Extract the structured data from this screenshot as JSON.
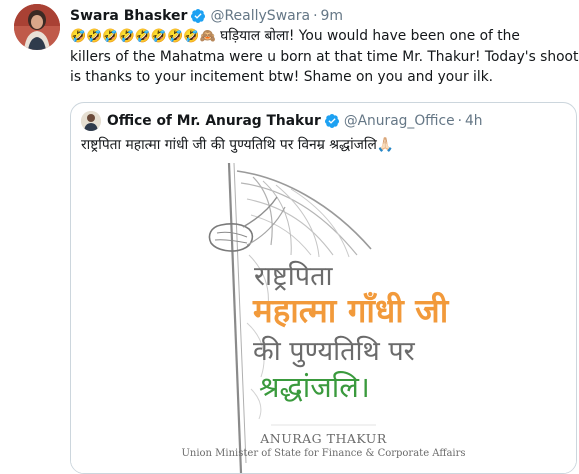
{
  "tweet": {
    "avatar_icon": "user-avatar",
    "display_name": "Swara Bhasker",
    "handle": "@ReallySwara",
    "separator": "·",
    "time": "9m",
    "verified_icon": "verified-badge-icon",
    "text_line1_emojis": "🤣🤣🤣🤣🤣🤣🤣🤣🙈",
    "text_line1": " घड़ियाल बोला! You would have been one of the",
    "text_line2": "killers of the Mahatma were u born at that time Mr. Thakur! Today's shooting",
    "text_line3": "is thanks to your incitement btw! Shame on you and your ilk."
  },
  "quoted_tweet": {
    "display_name": "Office of Mr. Anurag Thakur",
    "handle": "@Anurag_Office",
    "separator": "·",
    "time": "4h",
    "text": "राष्ट्रपिता महात्मा गांधी जी की पुण्यतिथि पर विनम्र श्रद्धांजलि🙏🏻",
    "image": {
      "line1": "राष्ट्रपिता",
      "line2": "महात्मा गाँधी जी",
      "line3": "की पुण्यतिथि पर",
      "line4": "श्रद्धांजलि।",
      "footer_name": "ANURAG THAKUR",
      "footer_title": "Union Minister of State for Finance & Corporate Affairs"
    }
  },
  "colors": {
    "verified": "#1da1f2",
    "secondary_text": "#657786",
    "poster_orange": "#f29a3b",
    "poster_green": "#3a9a3d",
    "poster_gray": "#6b6b6b"
  }
}
